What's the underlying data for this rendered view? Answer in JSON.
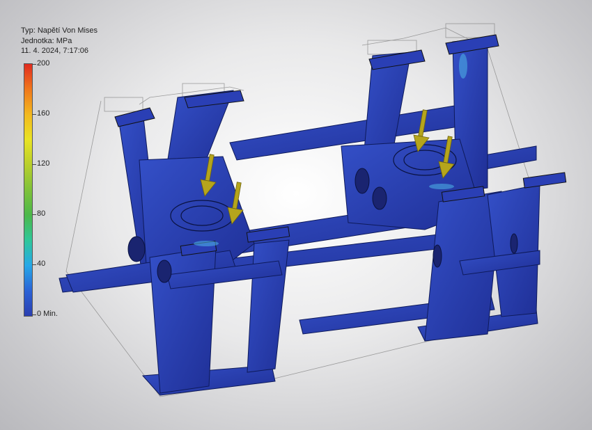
{
  "legend": {
    "type_line": "Typ: Napětí Von Mises",
    "unit_line": "Jednotka: MPa",
    "date_line": "11. 4. 2024, 7:17:06",
    "scale_labels": [
      "200",
      "160",
      "120",
      "80",
      "40",
      "0 Min."
    ],
    "scale_max": 200,
    "scale_min": 0,
    "scale_colors": [
      "#2b3fb0",
      "#26a8e8",
      "#4cb84a",
      "#e9e324",
      "#f0771c",
      "#e02b1f"
    ]
  },
  "model": {
    "body_color": "#2a3fb5",
    "load_arrow_color": "#b5a51c",
    "load_arrows_count": 4
  }
}
